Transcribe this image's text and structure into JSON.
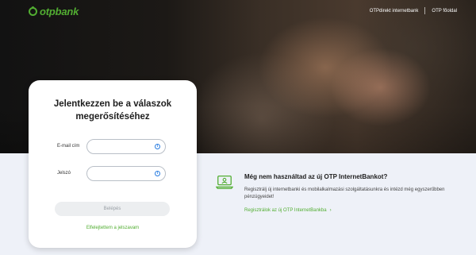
{
  "brand": {
    "name": "otpbank",
    "color": "#52ae32"
  },
  "header": {
    "nav": [
      {
        "label": "OTPdirekt internetbank"
      },
      {
        "label": "OTP főoldal"
      }
    ]
  },
  "login": {
    "title_line1": "Jelentkezzen be a válaszok",
    "title_line2": "megerősítéséhez",
    "email_label": "E-mail cím",
    "email_value": "",
    "password_label": "Jelszó",
    "password_value": "",
    "info_icon": "info-icon",
    "submit_label": "Belépés",
    "forgot_label": "Elfelejtettem a jelszavam"
  },
  "promo": {
    "icon": "laptop-user-icon",
    "title": "Még nem használtad az új OTP InternetBankot?",
    "text": "Regisztrálj új internetbanki és mobilalkalmazási szolgáltatásunkra és intézd még egyszerűbben pénzügyeidet!",
    "link_label": "Regisztrálok az új OTP InternetBankba"
  }
}
